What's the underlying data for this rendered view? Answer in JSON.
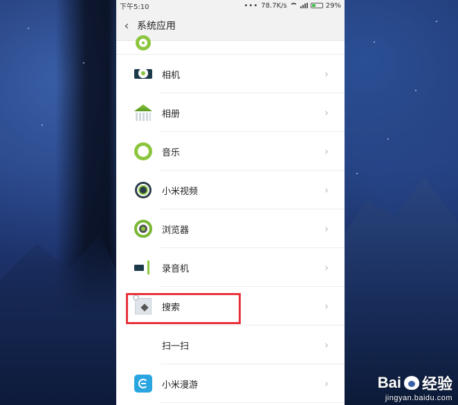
{
  "status_bar": {
    "time": "下午5:10",
    "dots": "•••",
    "network_speed": "78.7K/s",
    "battery": "29%"
  },
  "header": {
    "title": "系统应用"
  },
  "apps": [
    {
      "label": "相机",
      "icon": "camera-icon"
    },
    {
      "label": "相册",
      "icon": "gallery-icon"
    },
    {
      "label": "音乐",
      "icon": "music-icon"
    },
    {
      "label": "小米视频",
      "icon": "video-icon"
    },
    {
      "label": "浏览器",
      "icon": "browser-icon"
    },
    {
      "label": "录音机",
      "icon": "recorder-icon"
    },
    {
      "label": "搜索",
      "icon": "search-icon"
    },
    {
      "label": "扫一扫",
      "icon": ""
    },
    {
      "label": "小米漫游",
      "icon": "roaming-icon"
    }
  ],
  "chevron": "›",
  "back_glyph": "‹",
  "watermark": {
    "brand": "Bai",
    "brand_suffix": "经验",
    "url": "jingyan.baidu.com"
  },
  "colors": {
    "accent_green": "#8cc63f",
    "highlight_red": "#e8303a",
    "roaming_blue": "#2aa5e0"
  }
}
